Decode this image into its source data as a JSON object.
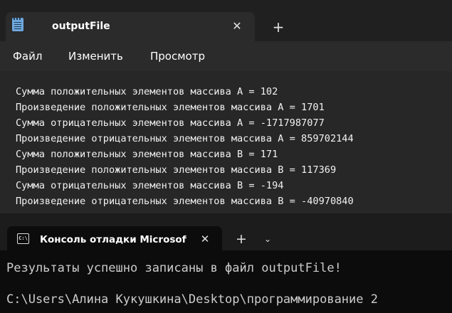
{
  "notepad": {
    "tab_title": "outputFile",
    "menu": [
      "Файл",
      "Изменить",
      "Просмотр"
    ],
    "lines": [
      "Сумма положительных элементов массива A = 102",
      "Произведение положительных элементов массива A = 1701",
      "Сумма отрицательных элементов массива A = -1717987077",
      "Произведение отрицательных элементов массива A = 859702144",
      "Сумма положительных элементов массива B = 171",
      "Произведение положительных элементов массива B = 117369",
      "Сумма отрицательных элементов массива B = -194",
      "Произведение отрицательных элементов массива B = -40970840"
    ]
  },
  "console": {
    "tab_title": "Консоль отладки Microsoft V",
    "icon_text": "C:\\",
    "lines": [
      "Результаты успешно записаны в файл outputFile!",
      "",
      "C:\\Users\\Алина Кукушкина\\Desktop\\программирование 2"
    ]
  },
  "icons": {
    "notepad_app": "notepad-icon",
    "close": "close-icon",
    "add": "plus-icon",
    "dropdown": "chevron-down-icon",
    "console_app": "terminal-icon"
  }
}
